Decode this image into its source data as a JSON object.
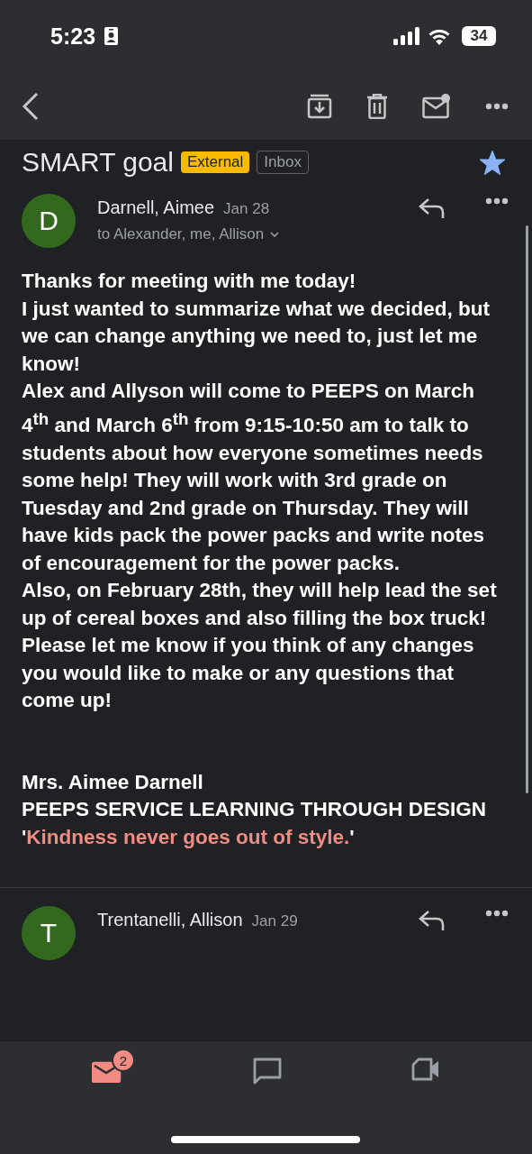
{
  "status_bar": {
    "time": "5:23",
    "battery": "34"
  },
  "subject": {
    "title": "SMART goal",
    "labels": [
      {
        "text": "External",
        "kind": "filled"
      },
      {
        "text": "Inbox",
        "kind": "outline"
      }
    ],
    "starred": true
  },
  "messages": [
    {
      "initial": "D",
      "sender": "Darnell, Aimee",
      "date": "Jan 28",
      "recipients": "to Alexander, me, Allison",
      "color": "#33691e",
      "body": [
        "Thanks for meeting with me today!",
        "I just wanted to summarize what we decided, but we can change anything we need to, just let me know!",
        "Alex and Allyson will come to PEEPS on March 4$^{th}$ and March 6$^{th}$ from 9:15-10:50 am to talk to students about how everyone sometimes needs some help!  They will work with 3rd grade on Tuesday and 2nd grade on Thursday.  They will have kids pack the power packs and write notes of encouragement for the power packs.",
        "Also, on February 28th, they will help lead the set up of cereal boxes and also filling the box truck!",
        "Please let me know if you think of any changes you would like to make or any questions that come up!"
      ],
      "signature": [
        "Mrs. Aimee Darnell",
        "PEEPS SERVICE LEARNING THROUGH DESIGN"
      ],
      "quote": {
        "open": "'",
        "text": "Kindness never goes out of style.",
        "close": "'"
      }
    },
    {
      "initial": "T",
      "sender": "Trentanelli, Allison",
      "date": "Jan 29",
      "color": "#33691e"
    }
  ],
  "bottom_nav": [
    {
      "kind": "mail",
      "badge": "2",
      "selected": true
    },
    {
      "kind": "chat",
      "selected": false
    },
    {
      "kind": "meet",
      "selected": false
    }
  ]
}
